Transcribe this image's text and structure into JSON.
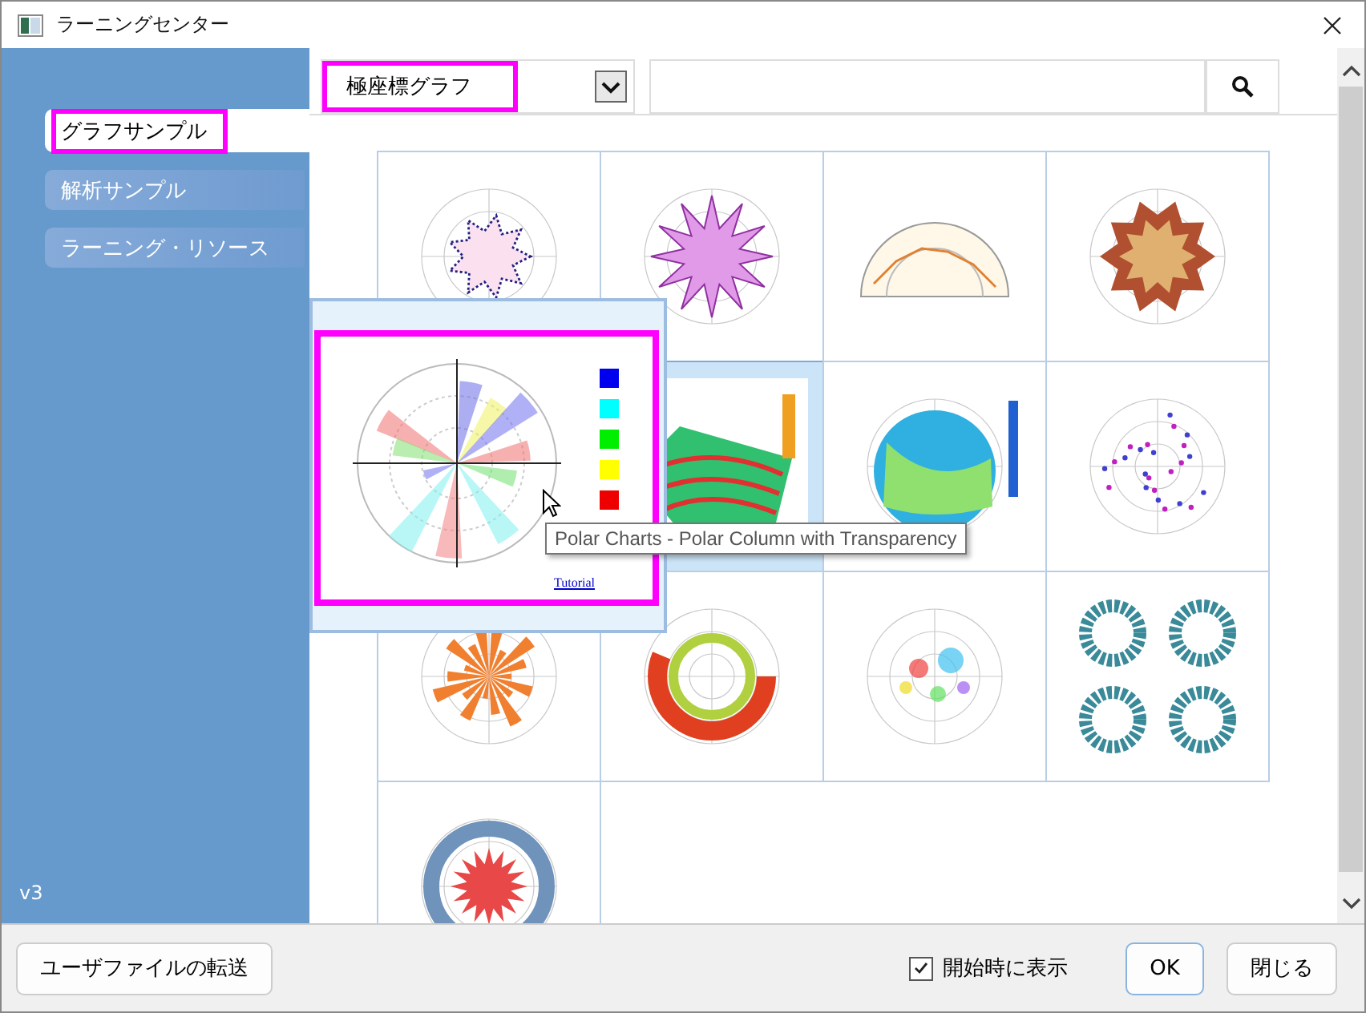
{
  "window": {
    "title": "ラーニングセンター"
  },
  "sidebar": {
    "items": [
      {
        "label": "グラフサンプル",
        "selected": true,
        "highlighted": true
      },
      {
        "label": "解析サンプル",
        "selected": false,
        "highlighted": false
      },
      {
        "label": "ラーニング・リソース",
        "selected": false,
        "highlighted": false
      }
    ],
    "version": "v3"
  },
  "category_dropdown": {
    "value": "極座標グラフ",
    "highlighted": true
  },
  "thumbnails": [
    {
      "kind": "line",
      "hovered": false
    },
    {
      "kind": "star",
      "hovered": false
    },
    {
      "kind": "half",
      "hovered": false
    },
    {
      "kind": "rose",
      "hovered": false
    },
    {
      "kind": "wedge",
      "hovered": true
    },
    {
      "kind": "disc",
      "hovered": false
    },
    {
      "kind": "scatter",
      "hovered": false
    },
    {
      "kind": "bars",
      "hovered": false
    },
    {
      "kind": "donut",
      "hovered": false
    },
    {
      "kind": "bubble",
      "hovered": false
    },
    {
      "kind": "quad",
      "hovered": false
    },
    {
      "kind": "ring",
      "hovered": false
    }
  ],
  "preview": {
    "link": "Tutorial",
    "highlighted": true,
    "tooltip": "Polar Charts - Polar Column with Transparency"
  },
  "footer": {
    "transfer_button": "ユーザファイルの転送",
    "show_on_startup": {
      "label": "開始時に表示",
      "checked": true
    },
    "buttons": [
      {
        "label": "OK",
        "default": true
      },
      {
        "label": "閉じる",
        "default": false
      }
    ]
  }
}
